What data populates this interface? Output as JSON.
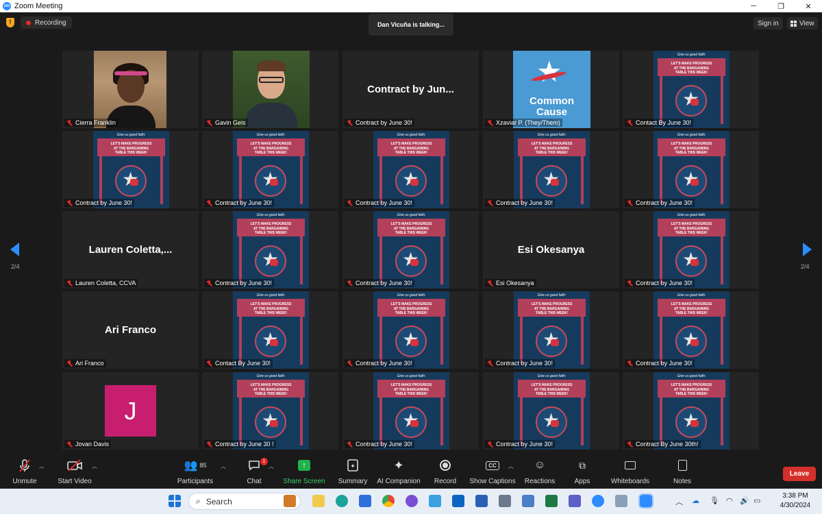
{
  "window": {
    "title": "Zoom Meeting",
    "app_badge": "zm"
  },
  "top": {
    "recording": "Recording",
    "talking": "Dan Vicuña is talking...",
    "sign_in": "Sign in",
    "view": "View"
  },
  "pagination": {
    "left": "2/4",
    "right": "2/4"
  },
  "poster": {
    "header": "Give us good faith:",
    "line1": "LET'S MAKE PROGRESS",
    "line2": "AT THE BARGAINING",
    "line3": "TABLE THIS WEEK!"
  },
  "tiles": [
    {
      "name": "Cierra Franklin"
    },
    {
      "name": "Gavin Geis"
    },
    {
      "name": "Contract by June 30!",
      "big": "Contract  by  Jun..."
    },
    {
      "name": "Xzaviar P. (They/Them)",
      "logo": "Common Cause"
    },
    {
      "name": "Contact By June 30!"
    },
    {
      "name": "Contract by June 30!"
    },
    {
      "name": "Contract by June 30!"
    },
    {
      "name": "Contract by June 30!"
    },
    {
      "name": "Contract by June 30!"
    },
    {
      "name": "Contract by June 30!"
    },
    {
      "name": "Lauren Coletta, CCVA",
      "big": "Lauren  Coletta,..."
    },
    {
      "name": "Contract by June 30!"
    },
    {
      "name": "Contract by June 30!"
    },
    {
      "name": "Esi Okesanya",
      "big": "Esi Okesanya"
    },
    {
      "name": "Contract by June 30!"
    },
    {
      "name": "Ari Franco",
      "big": "Ari Franco"
    },
    {
      "name": "Contact By June 30!"
    },
    {
      "name": "Contract by June 30!"
    },
    {
      "name": "Contract by June 30!"
    },
    {
      "name": "Contract by June 30!"
    },
    {
      "name": "Jovan Davis",
      "avatar": "J"
    },
    {
      "name": "Contract by June 30 !"
    },
    {
      "name": "Contract by June 30!"
    },
    {
      "name": "Contract by June 30!"
    },
    {
      "name": "Contract By June 30th!"
    }
  ],
  "toolbar": {
    "unmute": "Unmute",
    "start_video": "Start Video",
    "participants": "Participants",
    "participants_count": "85",
    "chat": "Chat",
    "chat_badge": "1",
    "share_screen": "Share Screen",
    "summary": "Summary",
    "ai_companion": "AI Companion",
    "record": "Record",
    "show_captions": "Show Captions",
    "captions_icon": "CC",
    "reactions": "Reactions",
    "apps": "Apps",
    "whiteboards": "Whiteboards",
    "notes": "Notes",
    "leave": "Leave"
  },
  "taskbar": {
    "search": "Search",
    "time": "3:38 PM",
    "date": "4/30/2024"
  },
  "colors": {
    "accent": "#2d8cff",
    "leave": "#d4302b",
    "share": "#22b14c",
    "poster_bg": "#163a5c",
    "poster_red": "#b3405a"
  }
}
